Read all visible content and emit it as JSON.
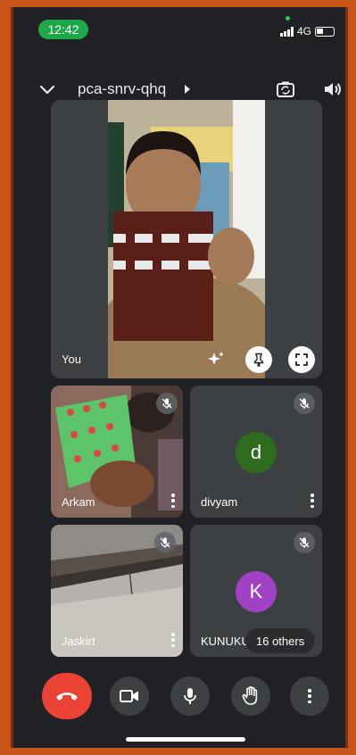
{
  "status_bar": {
    "time": "12:42",
    "network": "4G"
  },
  "top_bar": {
    "meeting_code": "pca-snrv-qhq"
  },
  "main_tile": {
    "label": "You"
  },
  "participants": [
    {
      "name": "Arkam",
      "muted": true
    },
    {
      "name": "divyam",
      "muted": true,
      "avatar_letter": "d",
      "avatar_color": "#2e6b1e"
    },
    {
      "name": "Jaskirt",
      "muted": true
    },
    {
      "name": "KUNUKU",
      "muted": true,
      "avatar_letter": "K",
      "avatar_color": "#a142c4"
    }
  ],
  "others_pill": "16 others",
  "colors": {
    "background": "#202124",
    "tile": "#3c4043",
    "end_call": "#ea4335",
    "time_pill": "#1fa84a",
    "frame": "#c9541a"
  }
}
